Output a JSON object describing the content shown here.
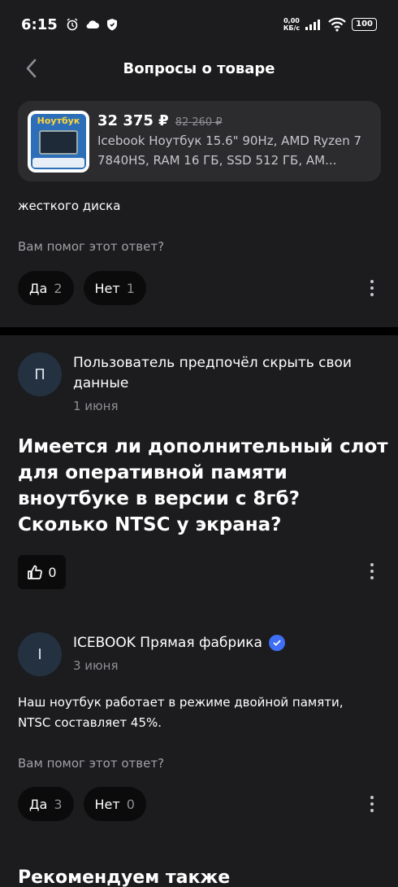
{
  "status_bar": {
    "time": "6:15",
    "net_speed_value": "0,00",
    "net_speed_unit": "КБ/с",
    "battery": "100"
  },
  "header": {
    "title": "Вопросы о товаре"
  },
  "product": {
    "price": "32 375 ₽",
    "old_price": "82 260 ₽",
    "description": "Icebook Ноутбук 15.6\" 90Hz, AMD Ryzen 7 7840HS, RAM 16 ГБ, SSD 512 ГБ, AM...",
    "thumb_label": "Ноутбук"
  },
  "prev_answer": {
    "text_fragment": "жесткого диска",
    "helpful_question": "Вам помог этот ответ?",
    "yes_label": "Да",
    "yes_count": "2",
    "no_label": "Нет",
    "no_count": "1"
  },
  "question": {
    "author_initial": "П",
    "author_name": "Пользователь предпочёл скрыть свои данные",
    "date": "1 июня",
    "text": "Имеется ли дополнительный слот для оперативной памяти вноутбуке в версии с 8гб?\nСколько NTSC у экрана?",
    "likes": "0"
  },
  "answer": {
    "author_initial": "I",
    "author_name": "ICEBOOK Прямая фабрика",
    "date": "3 июня",
    "text": "Наш ноутбук работает в режиме двойной памяти, NTSC составляет 45%.",
    "helpful_question": "Вам помог этот ответ?",
    "yes_label": "Да",
    "yes_count": "3",
    "no_label": "Нет",
    "no_count": "0"
  },
  "recommend": {
    "title": "Рекомендуем также"
  },
  "colors": {
    "background": "#1c1c1e",
    "card": "#2c2c2e",
    "button": "#0b0b0c",
    "verified": "#3d6ef5"
  }
}
